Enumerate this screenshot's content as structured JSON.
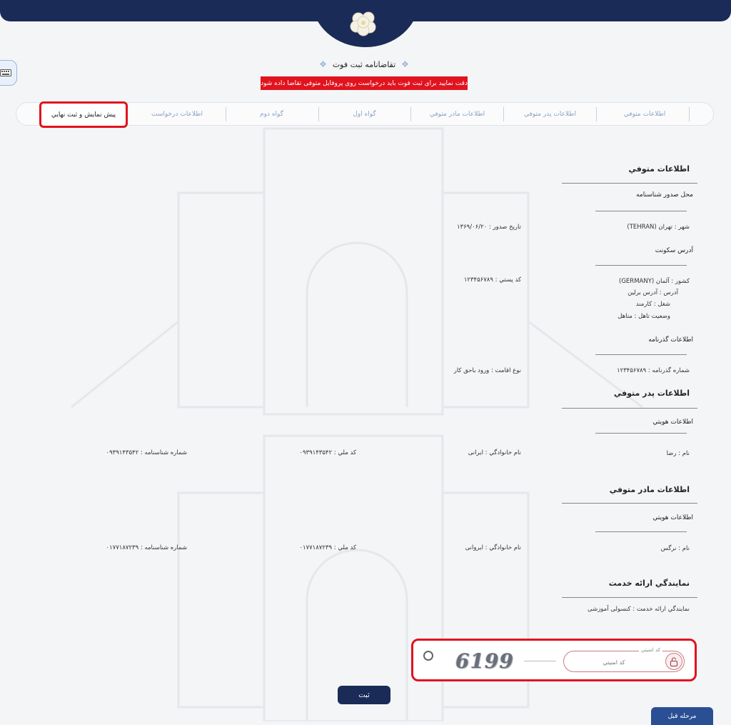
{
  "header": {
    "logo_icon": "flower-logo-icon"
  },
  "page_title": "تقاضانامه ثبت فوت",
  "warning": "دقت نمایید برای ثبت فوت باید درخواست روی پروفایل متوفی تقاضا داده شود",
  "tabs": [
    {
      "label": "اطلاعات متوفي"
    },
    {
      "label": "اطلاعات پدر متوفي"
    },
    {
      "label": "اطلاعات مادر متوفي"
    },
    {
      "label": "گواه اول"
    },
    {
      "label": "گواه دوم"
    },
    {
      "label": "اطلاعات درخواست"
    },
    {
      "label": "پيش نمايش و ثبت نهايي"
    }
  ],
  "deceased": {
    "title": "اطلاعات متوفي",
    "issue_place_title": "محل صدور شناسنامه",
    "city": "شهر : تهران (TEHRAN)",
    "issue_date": "تاريخ صدور : ۱۳۶۹/۰۶/۲۰",
    "address_title": "آدرس سکونت",
    "country": "کشور : آلمان (GERMANY)",
    "address": "آدرس : آدرس برلین",
    "job": "شغل : کارمند",
    "marital": "وضعيت تاهل : متاهل",
    "postal": "کد پستي : ۱۲۳۴۵۶۷۸۹",
    "passport_title": "اطلاعات گذرنامه",
    "passport_no": "شماره گذرنامه : ۱۲۳۴۵۶۷۸۹",
    "residence": "نوع اقامت : ورود باحق کار"
  },
  "father": {
    "title": "اطلاعات پدر متوفي",
    "identity_title": "اطلاعات هويتي",
    "name": "نام : رضا",
    "family": "نام خانوادگي : ایرانی",
    "national_code": "کد ملي : ۰۹۳۹۱۴۳۵۴۲",
    "id_number": "شماره شناسنامه : ۰۹۳۹۱۴۳۵۴۲"
  },
  "mother": {
    "title": "اطلاعات مادر متوفي",
    "identity_title": "اطلاعات هويتي",
    "name": "نام : نرگس",
    "family": "نام خانوادگي : ایروانی",
    "national_code": "کد ملي : ۰۱۷۷۱۸۷۲۳۹",
    "id_number": "شماره شناسنامه : ۰۱۷۷۱۸۷۲۳۹"
  },
  "service": {
    "title": "نمايندگي ارائه خدمت",
    "value": "نمايندگي ارائه خدمت : کنسولی آموزشی"
  },
  "captcha": {
    "legend": "کد امنيتي",
    "placeholder": "کد امنيتي",
    "image_text": "6199",
    "lock_icon": "lock-icon",
    "refresh_icon": "refresh-icon"
  },
  "buttons": {
    "submit": "ثبت",
    "previous": "مرحله قبل"
  },
  "colors": {
    "navy": "#1a2b57",
    "warning_red": "#e0131e",
    "button_blue": "#2b4f95"
  }
}
